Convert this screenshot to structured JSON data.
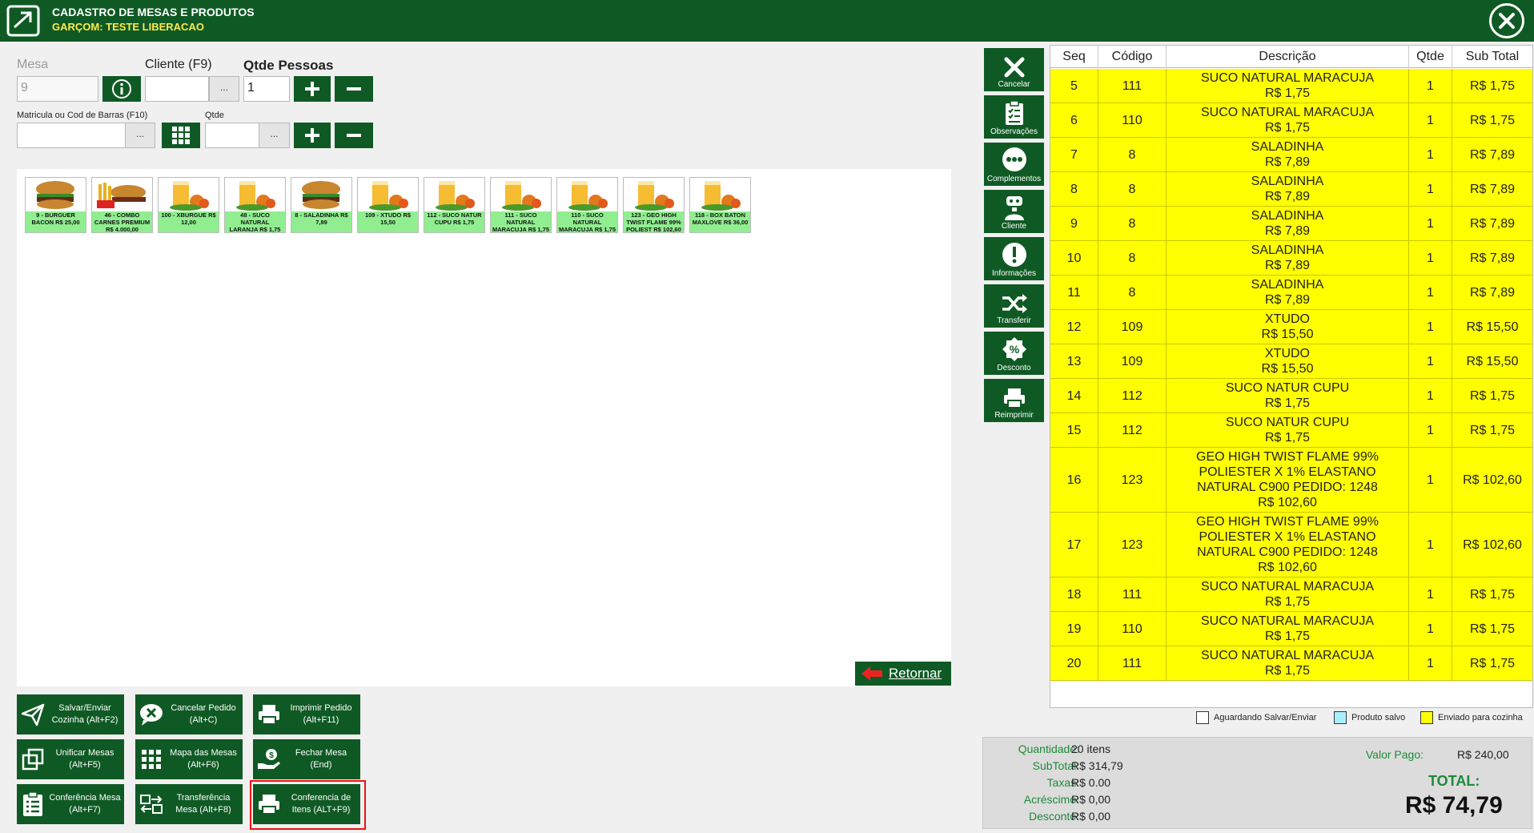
{
  "window": {
    "title": "CADASTRO DE MESAS E PRODUTOS",
    "subtitle": "GARÇOM: TESTE LIBERACAO",
    "close_icon": "close-circle-icon"
  },
  "header_form": {
    "mesa_label": "Mesa",
    "mesa_value": "9",
    "cliente_label": "Cliente (F9)",
    "cliente_value": "",
    "cliente_lookup": "...",
    "qtde_pessoas_label": "Qtde Pessoas",
    "qtde_pessoas_value": "1",
    "matricula_label": "Matricula ou Cod de Barras (F10)",
    "matricula_value": "",
    "matricula_lookup": "...",
    "qtde_label": "Qtde",
    "qtde_value": "",
    "qtde_lookup": "..."
  },
  "products": [
    {
      "label": "9 - BURGUER BACON R$ 25,00",
      "image": "burger"
    },
    {
      "label": "46 - COMBO CARNES PREMIUM R$ 4.000,00",
      "image": "combo"
    },
    {
      "label": "100 - XBURGUE R$ 12,00",
      "image": "juice"
    },
    {
      "label": "48 - SUCO NATURAL LARANJA R$ 1,75",
      "image": "juice"
    },
    {
      "label": "8 - SALADINHA R$ 7,89",
      "image": "burger"
    },
    {
      "label": "109 - XTUDO R$ 15,50",
      "image": "juice"
    },
    {
      "label": "112 - SUCO NATUR CUPU R$ 1,75",
      "image": "juice"
    },
    {
      "label": "111 - SUCO NATURAL MARACUJA R$ 1,75",
      "image": "juice"
    },
    {
      "label": "110 - SUCO NATURAL MARACUJA R$ 1,75",
      "image": "juice"
    },
    {
      "label": "123 - GEO HIGH TWIST FLAME 99% POLIEST R$ 102,60",
      "image": "juice"
    },
    {
      "label": "118 - BOX BATON MAXLOVE R$ 36,00",
      "image": "juice"
    }
  ],
  "retornar_label": "Retornar",
  "actions": {
    "salvar": "Salvar/Enviar Cozinha (Alt+F2)",
    "cancelar": "Cancelar Pedido (Alt+C)",
    "imprimir": "Imprimir Pedido (Alt+F11)",
    "unificar": "Unificar Mesas (Alt+F5)",
    "mapa": "Mapa das Mesas (Alt+F6)",
    "fechar": "Fechar Mesa (End)",
    "conferencia_mesa": "Conferência Mesa (Alt+F7)",
    "transferencia": "Transferência Mesa (Alt+F8)",
    "conferencia_itens": "Conferencia de Itens (ALT+F9)"
  },
  "sidebar": [
    {
      "label": "Cancelar",
      "icon": "x-icon"
    },
    {
      "label": "Observações",
      "icon": "clipboard-check-icon"
    },
    {
      "label": "Complementos",
      "icon": "more-dots-icon"
    },
    {
      "label": "Cliente",
      "icon": "person-icon"
    },
    {
      "label": "Informações",
      "icon": "exclamation-icon"
    },
    {
      "label": "Transferir",
      "icon": "shuffle-icon"
    },
    {
      "label": "Desconto",
      "icon": "percent-icon"
    },
    {
      "label": "Reimprimir",
      "icon": "printer-icon"
    }
  ],
  "grid": {
    "columns": [
      "Seq",
      "Código",
      "Descrição",
      "Qtde",
      "Sub Total"
    ],
    "rows": [
      {
        "seq": "5",
        "codigo": "111",
        "descricao": "SUCO NATURAL MARACUJA",
        "preco": "R$ 1,75",
        "qtde": "1",
        "subtotal": "R$ 1,75"
      },
      {
        "seq": "6",
        "codigo": "110",
        "descricao": "SUCO NATURAL MARACUJA",
        "preco": "R$ 1,75",
        "qtde": "1",
        "subtotal": "R$ 1,75"
      },
      {
        "seq": "7",
        "codigo": "8",
        "descricao": "SALADINHA",
        "preco": "R$ 7,89",
        "qtde": "1",
        "subtotal": "R$ 7,89"
      },
      {
        "seq": "8",
        "codigo": "8",
        "descricao": "SALADINHA",
        "preco": "R$ 7,89",
        "qtde": "1",
        "subtotal": "R$ 7,89"
      },
      {
        "seq": "9",
        "codigo": "8",
        "descricao": "SALADINHA",
        "preco": "R$ 7,89",
        "qtde": "1",
        "subtotal": "R$ 7,89"
      },
      {
        "seq": "10",
        "codigo": "8",
        "descricao": "SALADINHA",
        "preco": "R$ 7,89",
        "qtde": "1",
        "subtotal": "R$ 7,89"
      },
      {
        "seq": "11",
        "codigo": "8",
        "descricao": "SALADINHA",
        "preco": "R$ 7,89",
        "qtde": "1",
        "subtotal": "R$ 7,89"
      },
      {
        "seq": "12",
        "codigo": "109",
        "descricao": "XTUDO",
        "preco": "R$ 15,50",
        "qtde": "1",
        "subtotal": "R$ 15,50"
      },
      {
        "seq": "13",
        "codigo": "109",
        "descricao": "XTUDO",
        "preco": "R$ 15,50",
        "qtde": "1",
        "subtotal": "R$ 15,50"
      },
      {
        "seq": "14",
        "codigo": "112",
        "descricao": "SUCO NATUR CUPU",
        "preco": "R$ 1,75",
        "qtde": "1",
        "subtotal": "R$ 1,75"
      },
      {
        "seq": "15",
        "codigo": "112",
        "descricao": "SUCO NATUR CUPU",
        "preco": "R$ 1,75",
        "qtde": "1",
        "subtotal": "R$ 1,75"
      },
      {
        "seq": "16",
        "codigo": "123",
        "descricao": "GEO HIGH TWIST FLAME 99% POLIESTER X 1% ELASTANO NATURAL C900 PEDIDO: 1248",
        "preco": "R$ 102,60",
        "qtde": "1",
        "subtotal": "R$ 102,60"
      },
      {
        "seq": "17",
        "codigo": "123",
        "descricao": "GEO HIGH TWIST FLAME 99% POLIESTER X 1% ELASTANO NATURAL C900 PEDIDO: 1248",
        "preco": "R$ 102,60",
        "qtde": "1",
        "subtotal": "R$ 102,60"
      },
      {
        "seq": "18",
        "codigo": "111",
        "descricao": "SUCO NATURAL MARACUJA",
        "preco": "R$ 1,75",
        "qtde": "1",
        "subtotal": "R$ 1,75"
      },
      {
        "seq": "19",
        "codigo": "110",
        "descricao": "SUCO NATURAL MARACUJA",
        "preco": "R$ 1,75",
        "qtde": "1",
        "subtotal": "R$ 1,75"
      },
      {
        "seq": "20",
        "codigo": "111",
        "descricao": "SUCO NATURAL MARACUJA",
        "preco": "R$ 1,75",
        "qtde": "1",
        "subtotal": "R$ 1,75"
      }
    ]
  },
  "legend": [
    {
      "label": "Aguardando Salvar/Enviar",
      "color": "#ffffff"
    },
    {
      "label": "Produto salvo",
      "color": "#a8f0ff"
    },
    {
      "label": "Enviado para cozinha",
      "color": "#ffff00"
    }
  ],
  "summary": {
    "quantidade_label": "Quantidade:",
    "quantidade_value": "20 itens",
    "subtotal_label": "SubTotal:",
    "subtotal_value": "R$ 314,79",
    "taxas_label": "Taxas:",
    "taxas_value": "R$ 0.00",
    "acrescimo_label": "Acréscimo:",
    "acrescimo_value": "R$ 0,00",
    "desconto_label": "Desconto:",
    "desconto_value": "R$ 0,00",
    "valor_pago_label": "Valor Pago:",
    "valor_pago_value": "R$ 240,00",
    "total_label": "TOTAL:",
    "total_value": "R$ 74,79"
  },
  "colors": {
    "brand_green": "#0f5a24",
    "title_yellow": "#ffe94d",
    "row_sent": "#ffff00",
    "product_tile": "#90ee90",
    "highlight": "#ee1111"
  }
}
